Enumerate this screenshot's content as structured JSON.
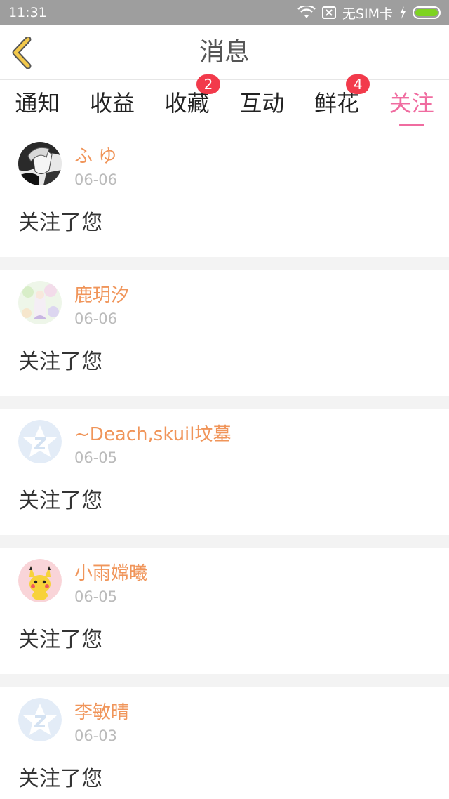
{
  "status_bar": {
    "time": "11:31",
    "sim_text": "无SIM卡",
    "icons": [
      "wifi-icon",
      "sim-off-icon",
      "charging-icon",
      "battery-icon"
    ],
    "battery_color": "#7ed321"
  },
  "header": {
    "title": "消息",
    "back_icon": "chevron-left-icon",
    "back_color": "#f2c84b"
  },
  "tabs": [
    {
      "label": "通知",
      "badge": null,
      "active": false
    },
    {
      "label": "收益",
      "badge": null,
      "active": false
    },
    {
      "label": "收藏",
      "badge": "2",
      "active": false
    },
    {
      "label": "互动",
      "badge": null,
      "active": false
    },
    {
      "label": "鲜花",
      "badge": "4",
      "active": false
    },
    {
      "label": "关注",
      "badge": null,
      "active": true
    }
  ],
  "colors": {
    "accent": "#f06ca0",
    "badge": "#f23a4b",
    "username": "#f0955a",
    "date": "#bbbbbb"
  },
  "items": [
    {
      "name": "ふ ゆ",
      "date": "06-06",
      "message": "关注了您",
      "avatar": "anime-avatar-icon"
    },
    {
      "name": "鹿玥汐",
      "date": "06-06",
      "message": "关注了您",
      "avatar": "flower-avatar-icon"
    },
    {
      "name": "~Deach,skuil坟墓",
      "date": "06-05",
      "message": "关注了您",
      "avatar": "default-star-avatar-icon"
    },
    {
      "name": "小雨嫦曦",
      "date": "06-05",
      "message": "关注了您",
      "avatar": "pikachu-avatar-icon"
    },
    {
      "name": "李敏晴",
      "date": "06-03",
      "message": "关注了您",
      "avatar": "default-star-avatar-icon"
    }
  ]
}
